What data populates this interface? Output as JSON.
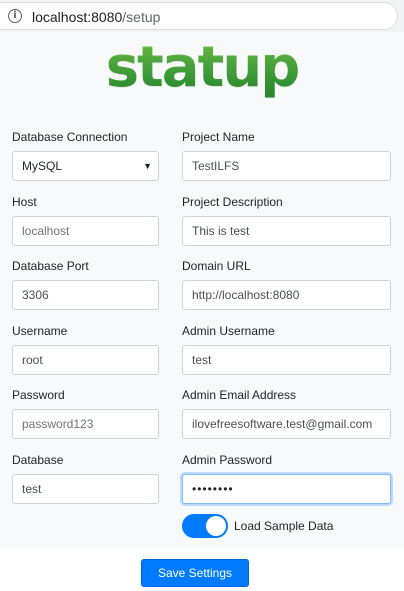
{
  "browser": {
    "url_host": "localhost:8080",
    "url_path": "/setup"
  },
  "logo": {
    "text": "statup"
  },
  "left_column": {
    "db_connection": {
      "label": "Database Connection",
      "value": "MySQL"
    },
    "host": {
      "label": "Host",
      "placeholder": "localhost"
    },
    "port": {
      "label": "Database Port",
      "value": "3306"
    },
    "username": {
      "label": "Username",
      "value": "root"
    },
    "password": {
      "label": "Password",
      "placeholder": "password123"
    },
    "database": {
      "label": "Database",
      "value": "test"
    }
  },
  "right_column": {
    "project_name": {
      "label": "Project Name",
      "value": "TestILFS"
    },
    "project_description": {
      "label": "Project Description",
      "value": "This is test"
    },
    "domain_url": {
      "label": "Domain URL",
      "value": "http://localhost:8080"
    },
    "admin_username": {
      "label": "Admin Username",
      "value": "test"
    },
    "admin_email": {
      "label": "Admin Email Address",
      "value": "ilovefreesoftware.test@gmail.com"
    },
    "admin_password": {
      "label": "Admin Password",
      "value": "••••••••"
    }
  },
  "sample_data": {
    "label": "Load Sample Data",
    "enabled": true
  },
  "save_button": {
    "label": "Save Settings"
  },
  "colors": {
    "primary": "#007bff",
    "logo_green": "#3fa33b",
    "page_bg": "#f8f9fa"
  },
  "icons": {
    "address_info": "info-icon",
    "select_caret": "caret-down-icon"
  }
}
